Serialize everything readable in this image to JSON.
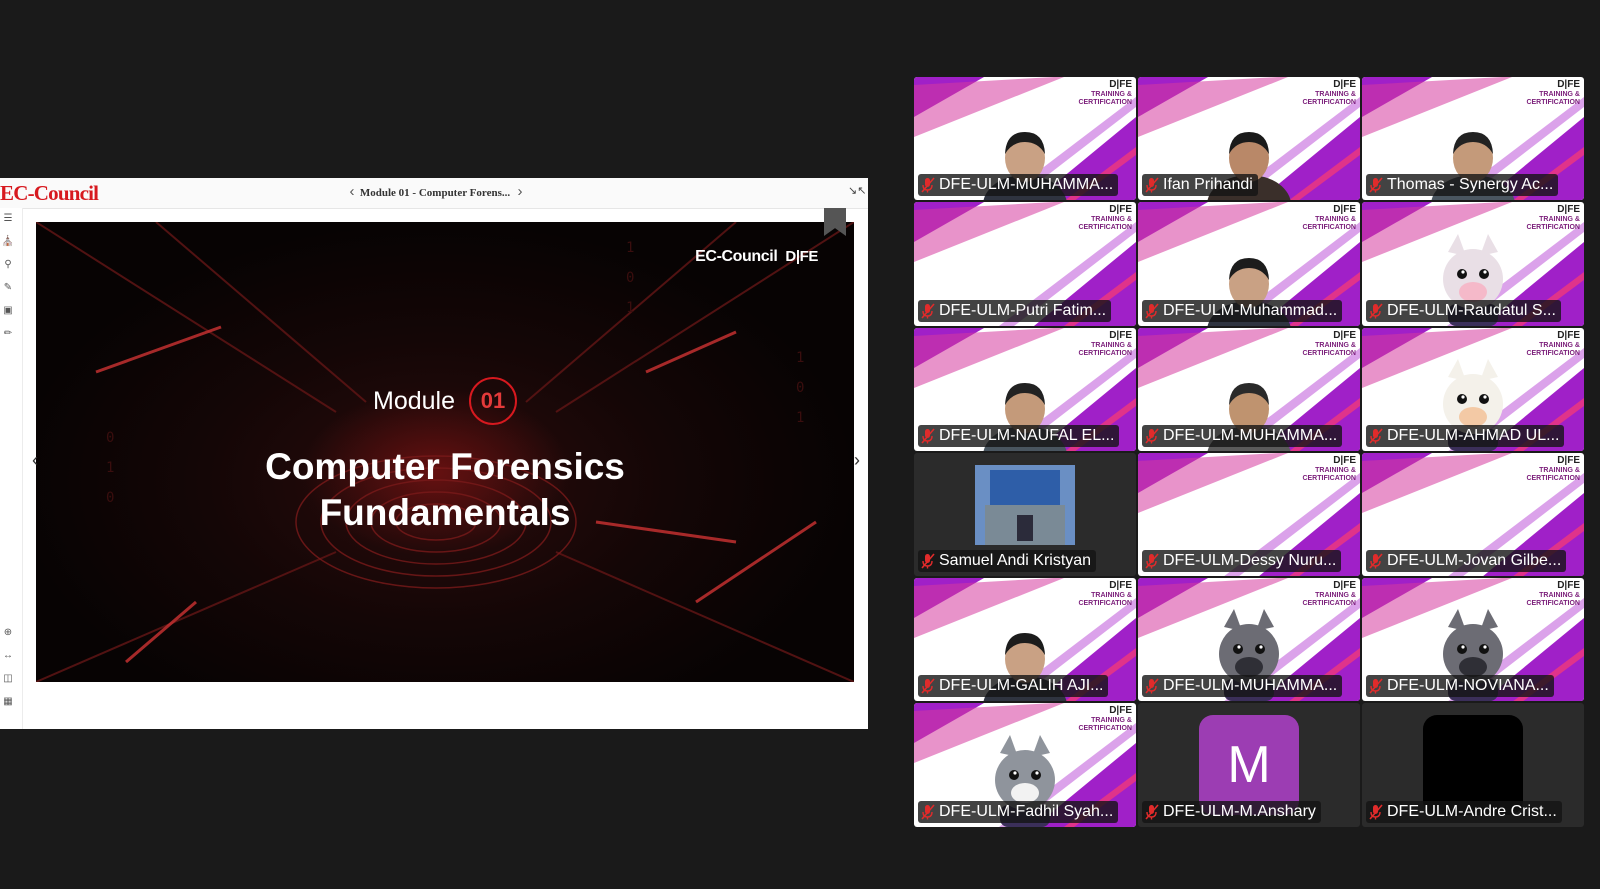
{
  "viewer": {
    "brand": "EC-Council",
    "breadcrumb": "Module 01 - Computer Forens...",
    "prev_icon": "chevron-left-icon",
    "next_icon": "chevron-right-icon",
    "collapse_icon": "collapse-icon",
    "left_tools": [
      "list-icon",
      "tag-icon",
      "search-icon",
      "pen-icon",
      "note-icon",
      "highlighter-icon"
    ],
    "bottom_tools": [
      "zoom-in-icon",
      "fit-width-icon",
      "book-icon",
      "grid-icon"
    ]
  },
  "slide": {
    "logo_left": "EC-Council",
    "logo_right": "D|FE",
    "module_word": "Module",
    "module_number": "01",
    "title_line1": "Computer Forensics",
    "title_line2": "Fundamentals"
  },
  "tile_badge": {
    "line1": "D|FE",
    "line2": "TRAINING &",
    "line3": "CERTIFICATION"
  },
  "participants": [
    {
      "name": "DFE-ULM-MUHAMMA...",
      "video": "person",
      "muted": true
    },
    {
      "name": "Ifan Prihandi",
      "video": "person",
      "muted": true
    },
    {
      "name": "Thomas - Synergy Ac...",
      "video": "person",
      "muted": true
    },
    {
      "name": "DFE-ULM-Putri Fatim...",
      "video": "background",
      "muted": true
    },
    {
      "name": "DFE-ULM-Muhammad...",
      "video": "person",
      "muted": true
    },
    {
      "name": "DFE-ULM-Raudatul S...",
      "video": "bunny-avatar",
      "muted": true
    },
    {
      "name": "DFE-ULM-NAUFAL EL...",
      "video": "person",
      "muted": true
    },
    {
      "name": "DFE-ULM-MUHAMMA...",
      "video": "person",
      "muted": true
    },
    {
      "name": "DFE-ULM-AHMAD UL...",
      "video": "cow-avatar",
      "muted": true
    },
    {
      "name": "Samuel Andi Kristyan",
      "video": "photo",
      "muted": true
    },
    {
      "name": "DFE-ULM-Dessy Nuru...",
      "video": "background",
      "muted": true
    },
    {
      "name": "DFE-ULM-Jovan Gilbe...",
      "video": "background",
      "muted": true
    },
    {
      "name": "DFE-ULM-GALIH AJI...",
      "video": "person",
      "muted": true
    },
    {
      "name": "DFE-ULM-MUHAMMA...",
      "video": "raccoon-avatar",
      "muted": true
    },
    {
      "name": "DFE-ULM-NOVIANA...",
      "video": "raccoon-avatar",
      "muted": true
    },
    {
      "name": "DFE-ULM-Fadhil Syah...",
      "video": "husky-avatar",
      "muted": true
    },
    {
      "name": "DFE-ULM-M.Anshary",
      "video": "initial",
      "initial": "M",
      "muted": true
    },
    {
      "name": "DFE-ULM-Andre Crist...",
      "video": "off",
      "muted": true
    }
  ],
  "colors": {
    "brand_red": "#d7191f",
    "stripe_purple": "#a020c8",
    "stripe_pink": "#e0338a",
    "avatar_purple": "#9c3db3",
    "mute_red": "#e02b2b"
  }
}
